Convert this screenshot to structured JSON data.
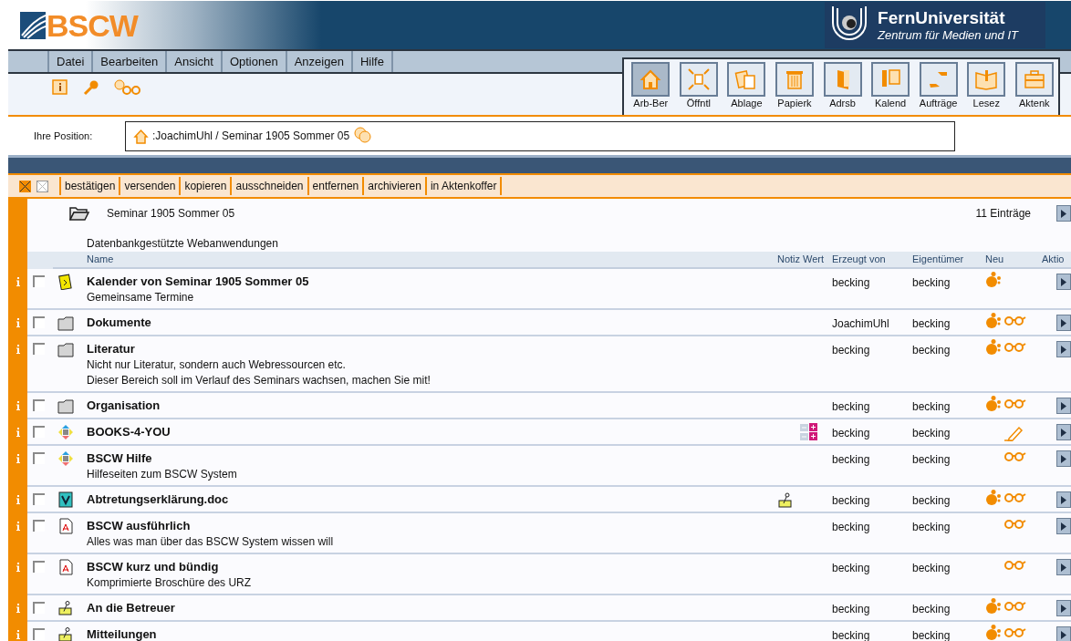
{
  "header": {
    "logo_text": "BSCW",
    "org_name": "FernUniversität",
    "org_subtitle": "Zentrum für Medien und IT"
  },
  "menu": [
    "Datei",
    "Bearbeiten",
    "Ansicht",
    "Optionen",
    "Anzeigen",
    "Hilfe"
  ],
  "toolbar": [
    {
      "label": "Arb-Ber",
      "kind": "home",
      "selected": true
    },
    {
      "label": "Öffntl",
      "kind": "public",
      "selected": false
    },
    {
      "label": "Ablage",
      "kind": "clipboard",
      "selected": false
    },
    {
      "label": "Papierk",
      "kind": "trash",
      "selected": false
    },
    {
      "label": "Adrsb",
      "kind": "addressbook",
      "selected": false
    },
    {
      "label": "Kalend",
      "kind": "calendar",
      "selected": false
    },
    {
      "label": "Aufträge",
      "kind": "tasks",
      "selected": false
    },
    {
      "label": "Lesez",
      "kind": "bookmarks",
      "selected": false
    },
    {
      "label": "Aktenk",
      "kind": "briefcase",
      "selected": false
    }
  ],
  "position": {
    "label": "Ihre Position:",
    "path": ":JoachimUhl / Seminar 1905 Sommer 05"
  },
  "actions": [
    "bestätigen",
    "versenden",
    "kopieren",
    "ausschneiden",
    "entfernen",
    "archivieren",
    "in Aktenkoffer"
  ],
  "folder": {
    "title": "Seminar 1905 Sommer 05",
    "count": "11 Einträge",
    "description": "Datenbankgestützte Webanwendungen"
  },
  "columns": [
    "Name",
    "Notiz",
    "Wert",
    "Erzeugt von",
    "Eigentümer",
    "Neu",
    "Aktio"
  ],
  "rows": [
    {
      "kind": "calendar",
      "name": "Kalender von Seminar 1905 Sommer 05",
      "description": [
        "Gemeinsame Termine"
      ],
      "checked": false,
      "note": false,
      "rating": false,
      "creator": "becking",
      "owner": "becking",
      "new": true,
      "read": false,
      "changed": false
    },
    {
      "kind": "folder",
      "name": "Dokumente",
      "description": [],
      "checked": false,
      "note": false,
      "rating": false,
      "creator": "JoachimUhl",
      "owner": "becking",
      "new": true,
      "read": true,
      "changed": false
    },
    {
      "kind": "folder",
      "name": "Literatur",
      "description": [
        "Nicht nur Literatur, sondern auch Webressourcen etc.",
        "Dieser Bereich soll im Verlauf des Seminars wachsen, machen Sie mit!"
      ],
      "checked": false,
      "note": false,
      "rating": false,
      "creator": "becking",
      "owner": "becking",
      "new": true,
      "read": true,
      "changed": false
    },
    {
      "kind": "folder",
      "name": "Organisation",
      "description": [],
      "checked": false,
      "note": false,
      "rating": false,
      "creator": "becking",
      "owner": "becking",
      "new": true,
      "read": true,
      "changed": false
    },
    {
      "kind": "url",
      "name": "BOOKS-4-YOU",
      "description": [],
      "checked": false,
      "note": false,
      "rating": true,
      "creator": "becking",
      "owner": "becking",
      "new": false,
      "read": false,
      "changed": true
    },
    {
      "kind": "url",
      "name": "BSCW Hilfe",
      "description": [
        "Hilfeseiten zum BSCW System"
      ],
      "checked": false,
      "note": false,
      "rating": false,
      "creator": "becking",
      "owner": "becking",
      "new": false,
      "read": true,
      "changed": false
    },
    {
      "kind": "doc",
      "name": "Abtretungserklärung.doc",
      "description": [],
      "checked": false,
      "note": true,
      "rating": false,
      "creator": "becking",
      "owner": "becking",
      "new": true,
      "read": true,
      "changed": false
    },
    {
      "kind": "pdf",
      "name": "BSCW ausführlich",
      "description": [
        "Alles was man über das BSCW System wissen will"
      ],
      "checked": false,
      "note": false,
      "rating": false,
      "creator": "becking",
      "owner": "becking",
      "new": false,
      "read": true,
      "changed": false
    },
    {
      "kind": "pdf",
      "name": "BSCW kurz und bündig",
      "description": [
        "Komprimierte Broschüre des URZ"
      ],
      "checked": false,
      "note": false,
      "rating": false,
      "creator": "becking",
      "owner": "becking",
      "new": false,
      "read": true,
      "changed": false
    },
    {
      "kind": "note",
      "name": "An die Betreuer",
      "description": [],
      "checked": false,
      "note": false,
      "rating": false,
      "creator": "becking",
      "owner": "becking",
      "new": true,
      "read": true,
      "changed": false
    },
    {
      "kind": "note",
      "name": "Mitteilungen",
      "description": [],
      "checked": false,
      "note": false,
      "rating": false,
      "creator": "becking",
      "owner": "becking",
      "new": true,
      "read": true,
      "changed": false
    }
  ]
}
